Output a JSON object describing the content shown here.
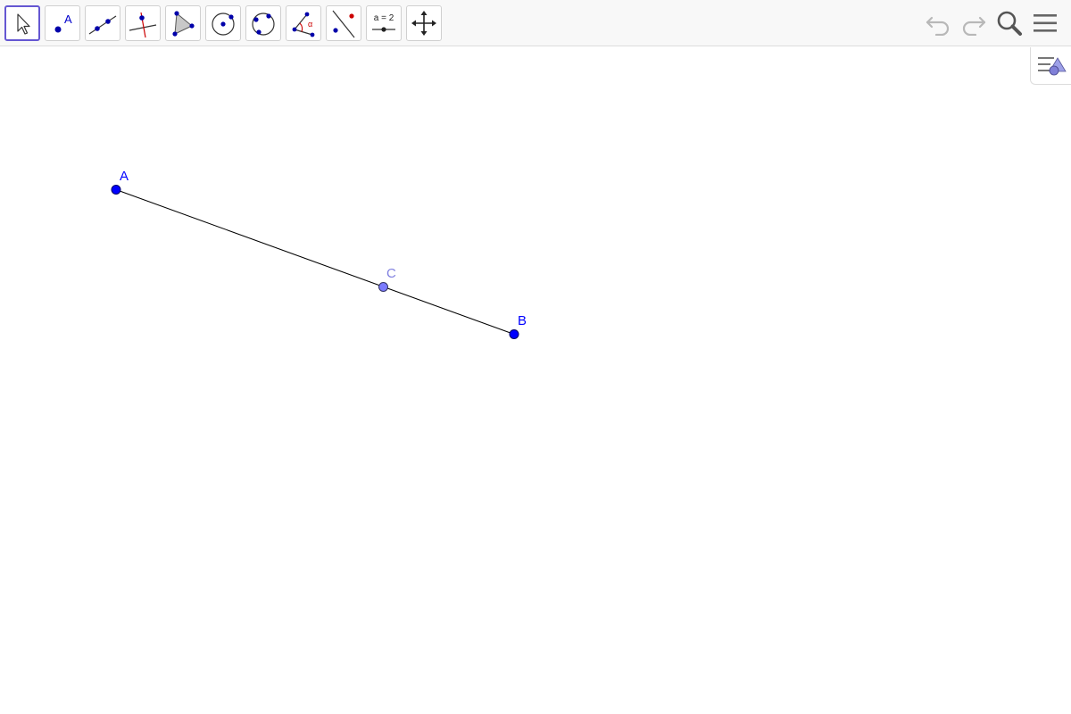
{
  "toolbar": {
    "tools": [
      {
        "name": "move-tool",
        "icon": "arrow-cursor-icon",
        "selected": true
      },
      {
        "name": "point-tool",
        "icon": "point-icon",
        "glyph": "A"
      },
      {
        "name": "line-tool",
        "icon": "line-through-two-points-icon"
      },
      {
        "name": "perpendicular-line-tool",
        "icon": "perpendicular-line-icon"
      },
      {
        "name": "polygon-tool",
        "icon": "polygon-icon"
      },
      {
        "name": "circle-center-point-tool",
        "icon": "circle-with-center-icon"
      },
      {
        "name": "circle-three-points-tool",
        "icon": "circle-three-points-icon"
      },
      {
        "name": "angle-tool",
        "icon": "angle-icon",
        "glyph": "α"
      },
      {
        "name": "reflect-about-line-tool",
        "icon": "reflect-icon"
      },
      {
        "name": "slider-tool",
        "icon": "slider-icon",
        "glyph": "a = 2"
      },
      {
        "name": "move-graphics-view-tool",
        "icon": "move-arrows-icon"
      }
    ],
    "actions": [
      {
        "name": "undo-button",
        "icon": "undo-icon"
      },
      {
        "name": "redo-button",
        "icon": "redo-icon"
      },
      {
        "name": "search-button",
        "icon": "search-icon"
      },
      {
        "name": "main-menu-button",
        "icon": "hamburger-menu-icon"
      }
    ]
  },
  "style_bar_toggle": {
    "icon": "style-bar-icon"
  },
  "colors": {
    "accent": "#6557d2",
    "point_free": "#0000ff",
    "point_dependent": "#7b7bff",
    "label_dependent": "#8080e0",
    "segment": "#000000",
    "toolbar_bg": "#f8f8f8"
  },
  "construction": {
    "points": [
      {
        "label": "A",
        "type": "free"
      },
      {
        "label": "B",
        "type": "free"
      },
      {
        "label": "C",
        "type": "point-on-segment"
      }
    ],
    "segments": [
      {
        "from": "A",
        "to": "B"
      }
    ]
  }
}
